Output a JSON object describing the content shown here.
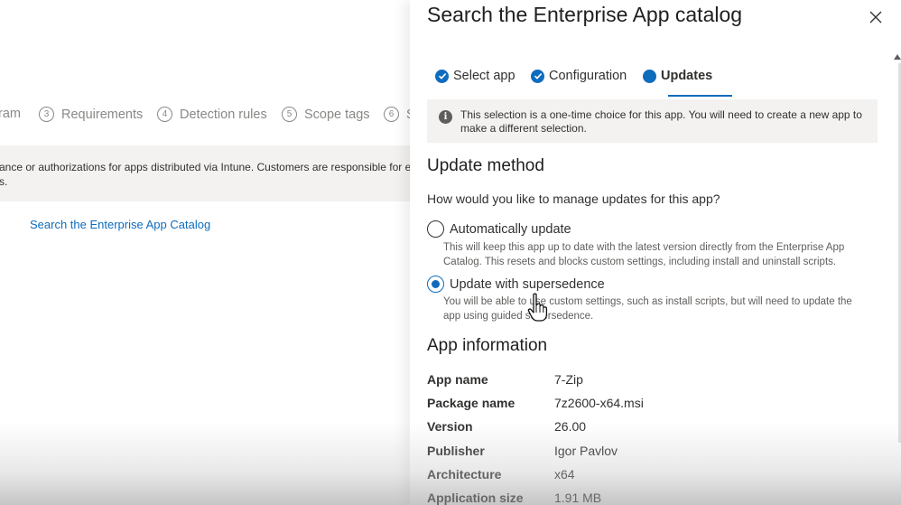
{
  "background": {
    "wizard_steps": [
      {
        "num": "",
        "label": "ram"
      },
      {
        "num": "3",
        "label": "Requirements"
      },
      {
        "num": "4",
        "label": "Detection rules"
      },
      {
        "num": "5",
        "label": "Scope tags"
      },
      {
        "num": "6",
        "label": "S"
      }
    ],
    "notice_line1": "ance or authorizations for apps distributed via Intune. Customers are responsible for ensurin",
    "notice_line2": "s.",
    "catalog_link": "Search the Enterprise App Catalog"
  },
  "panel": {
    "title": "Search the Enterprise App catalog",
    "tabs": [
      {
        "label": "Select app",
        "state": "done"
      },
      {
        "label": "Configuration",
        "state": "done"
      },
      {
        "label": "Updates",
        "state": "active"
      }
    ],
    "info_message": "This selection is a one-time choice for this app. You will need to create a new app to make a different selection.",
    "update_method": {
      "heading": "Update method",
      "question": "How would you like to manage updates for this app?",
      "options": [
        {
          "label": "Automatically update",
          "description": "This will keep this app up to date with the latest version directly from the Enterprise App Catalog. This resets and blocks custom settings, including install and uninstall scripts.",
          "selected": false
        },
        {
          "label": "Update with supersedence",
          "description": "You will be able to use custom settings, such as install scripts, but will need to update the app using guided supersedence.",
          "selected": true
        }
      ]
    },
    "app_information": {
      "heading": "App information",
      "rows": [
        {
          "key": "App name",
          "value": "7-Zip"
        },
        {
          "key": "Package name",
          "value": "7z2600-x64.msi"
        },
        {
          "key": "Version",
          "value": "26.00"
        },
        {
          "key": "Publisher",
          "value": "Igor Pavlov"
        },
        {
          "key": "Architecture",
          "value": "x64"
        },
        {
          "key": "Application size",
          "value": "1.91 MB"
        }
      ]
    }
  },
  "colors": {
    "accent": "#0f6cbd",
    "info_bg": "#f3f2f1",
    "text": "#323130"
  },
  "icons": [
    "info-icon",
    "close-icon",
    "checkmark-icon",
    "hand-pointer-icon"
  ]
}
